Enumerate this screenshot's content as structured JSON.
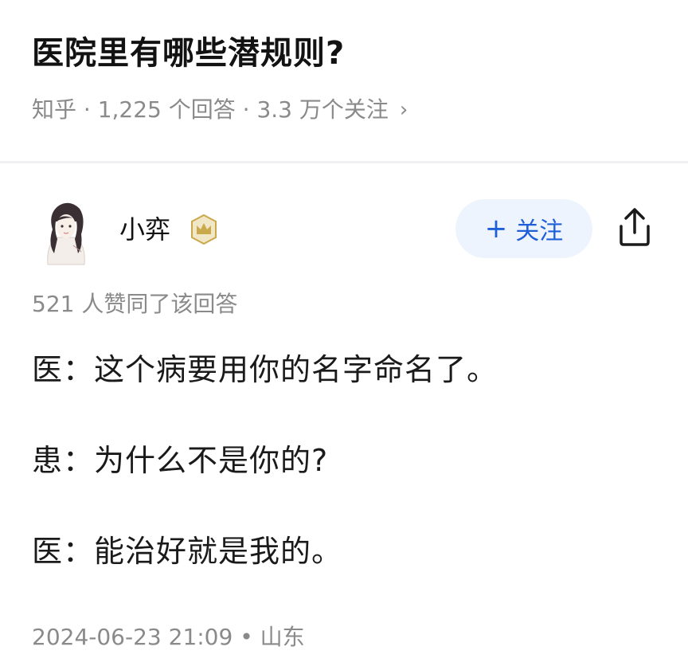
{
  "question": {
    "title": "医院里有哪些潜规则?",
    "meta": "知乎 · 1,225 个回答 · 3.3 万个关注",
    "chevron": "›"
  },
  "author": {
    "name": "小弈",
    "badge_icon": "crown-badge-icon",
    "avatar": "avatar-illustration"
  },
  "actions": {
    "follow_plus": "+",
    "follow_label": "关注",
    "share_icon": "share-icon"
  },
  "answer": {
    "vote_text": "521 人赞同了该回答",
    "lines": [
      "医：这个病要用你的名字命名了。",
      "患：为什么不是你的?",
      "医：能治好就是我的。"
    ],
    "footer": "2024-06-23 21:09 • 山东"
  },
  "colors": {
    "accent": "#1e5fd8",
    "follow_bg": "#eef4fe",
    "muted_text": "#8a8a8a",
    "badge": "#c9a94a"
  }
}
